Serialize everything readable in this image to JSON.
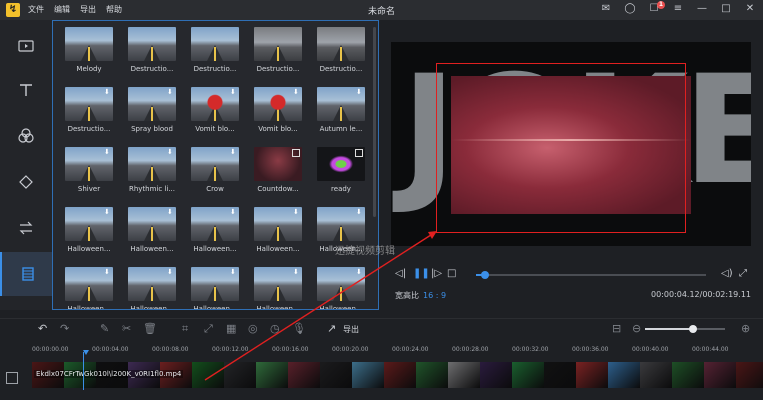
{
  "titlebar": {
    "title": "未命名",
    "menu": [
      "文件",
      "编辑",
      "导出",
      "帮助"
    ],
    "notification_count": "1"
  },
  "library": {
    "items": [
      {
        "label": "Melody",
        "style": "road",
        "download": false
      },
      {
        "label": "Destructio...",
        "style": "road",
        "download": false
      },
      {
        "label": "Destructio...",
        "style": "road",
        "download": false
      },
      {
        "label": "Destructio...",
        "style": "smoke",
        "download": false
      },
      {
        "label": "Destructio...",
        "style": "smoke",
        "download": false
      },
      {
        "label": "Destructio...",
        "style": "road",
        "download": true
      },
      {
        "label": "Spray blood",
        "style": "road",
        "download": true
      },
      {
        "label": "Vomit blo...",
        "style": "road-red",
        "download": true
      },
      {
        "label": "Vomit blo...",
        "style": "road-red",
        "download": true
      },
      {
        "label": "Autumn le...",
        "style": "road",
        "download": true
      },
      {
        "label": "Shiver",
        "style": "road",
        "download": true
      },
      {
        "label": "Rhythmic li...",
        "style": "road",
        "download": true
      },
      {
        "label": "Crow",
        "style": "road",
        "download": true
      },
      {
        "label": "Countdow...",
        "style": "red",
        "download": false
      },
      {
        "label": "ready",
        "style": "black",
        "download": false
      },
      {
        "label": "Halloween...",
        "style": "road",
        "download": true
      },
      {
        "label": "Halloween...",
        "style": "road",
        "download": true
      },
      {
        "label": "Halloween...",
        "style": "road",
        "download": true
      },
      {
        "label": "Halloween...",
        "style": "road",
        "download": true
      },
      {
        "label": "Halloween...",
        "style": "road",
        "download": true
      },
      {
        "label": "Halloween...",
        "style": "road",
        "download": true
      },
      {
        "label": "Halloween...",
        "style": "road",
        "download": true
      },
      {
        "label": "Halloween...",
        "style": "road",
        "download": true
      },
      {
        "label": "Halloween...",
        "style": "road",
        "download": true
      },
      {
        "label": "Halloween...",
        "style": "road",
        "download": true
      }
    ]
  },
  "preview": {
    "aspect_label": "宽高比",
    "aspect_value": "16 : 9",
    "current_time": "00:00:04.12",
    "total_time": "00:02:19.11",
    "progress": 0.04,
    "watermark": "迅捷视频剪辑"
  },
  "toolbar": {
    "export_label": "导出",
    "zoom_level": 0.6
  },
  "timeline": {
    "ticks": [
      "00:00:00.00",
      "00:00:04.00",
      "00:00:08.00",
      "00:00:12.00",
      "00:00:16.00",
      "00:00:20.00",
      "00:00:24.00",
      "00:00:28.00",
      "00:00:32.00",
      "00:00:36.00",
      "00:00:40.00",
      "00:00:44.00"
    ],
    "clip_name": "Ekdlx07CFrTwGk010l\\l200K_v0RI1fl0.mp4"
  },
  "colors": {
    "accent": "#3b8fe8",
    "highlight_box": "#e02020"
  }
}
